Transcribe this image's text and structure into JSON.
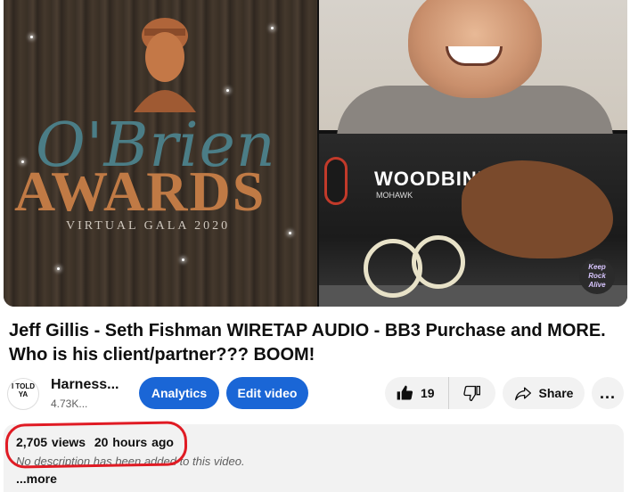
{
  "video": {
    "thumbnail_left_text": {
      "script_title": "O'Brien",
      "main_title": "AWARDS",
      "subtitle": "VIRTUAL GALA 2020"
    },
    "thumbnail_right_text": {
      "sign": "WOODBINE",
      "sign_sub": "MOHAWK",
      "watermark": "Keep Rock Alive"
    },
    "title": "Jeff Gillis - Seth Fishman WIRETAP AUDIO - BB3 Purchase and MORE. Who is his client/partner??? BOOM!"
  },
  "channel": {
    "logo_text": "I TOLD YA",
    "name": "Harness...",
    "subscribers": "4.73K..."
  },
  "actions": {
    "analytics_label": "Analytics",
    "edit_video_label": "Edit video",
    "like_count": "19",
    "share_label": "Share",
    "more_label": "..."
  },
  "description": {
    "views": "2,705 views",
    "age": "20 hours ago",
    "placeholder": "No description has been added to this video.",
    "show_more": "...more"
  },
  "colors": {
    "accent": "#1a66d6",
    "highlight": "#e01b24",
    "chip_bg": "#f2f2f2"
  }
}
